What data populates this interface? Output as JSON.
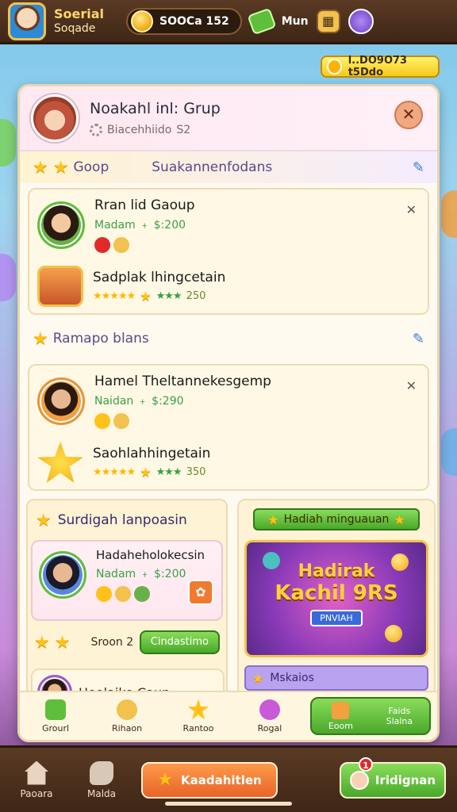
{
  "top": {
    "player_name": "Soerial",
    "player_sub": "Soqade",
    "coins": "SOOCa 152",
    "menu": "Mun"
  },
  "coin_badge": "l..DO9O73 t5Ddo",
  "panel": {
    "title": "Noakahl inl: Grup",
    "subtitle": "Biacehhiido",
    "subtitle_num": "S2",
    "close": "✕",
    "section1": {
      "left": "Goop",
      "right": "Suakannenfodans"
    },
    "card1": {
      "member_name": "Rran lid Gaoup",
      "member_meta": "Madam ﹢ $:200",
      "item_name": "Sadplak lhingcetain",
      "item_rating": "250"
    },
    "section2": {
      "title": "Ramapo blans"
    },
    "card2": {
      "member_name": "Hamel Theltannekesgemp",
      "member_meta": "Naidan ﹢ $:290",
      "item_name": "Saohlahhingetain",
      "item_rating": "350"
    },
    "left": {
      "title": "Surdigah lanpoasin",
      "reward_name": "Hadaheholokecsin",
      "reward_meta": "Nadam ﹢ $:200",
      "count_label": "Sroon 2",
      "button": "Cindastimo",
      "bottom_card": "Heolaike Caup"
    },
    "right": {
      "weekly_tag": "Hadiah minguauan",
      "promo_line1": "Hadirak",
      "promo_line2": "Kachil 9RS",
      "promo_tag": "PNVIAH",
      "lilac": "Mskaios"
    },
    "tabs": [
      {
        "label": "Grourl"
      },
      {
        "label": "Rihaon"
      },
      {
        "label": "Rantoo"
      },
      {
        "label": "Rogal"
      }
    ],
    "green_tabs": [
      {
        "label": "Eoom"
      },
      {
        "label": "Slalna"
      }
    ],
    "green_tabs_top": "Faids"
  },
  "footer": {
    "tab1": "Paoara",
    "tab2": "Malda",
    "orange_button": "Kaadahitlen",
    "green_button": "Iridignan",
    "badge": "1"
  }
}
